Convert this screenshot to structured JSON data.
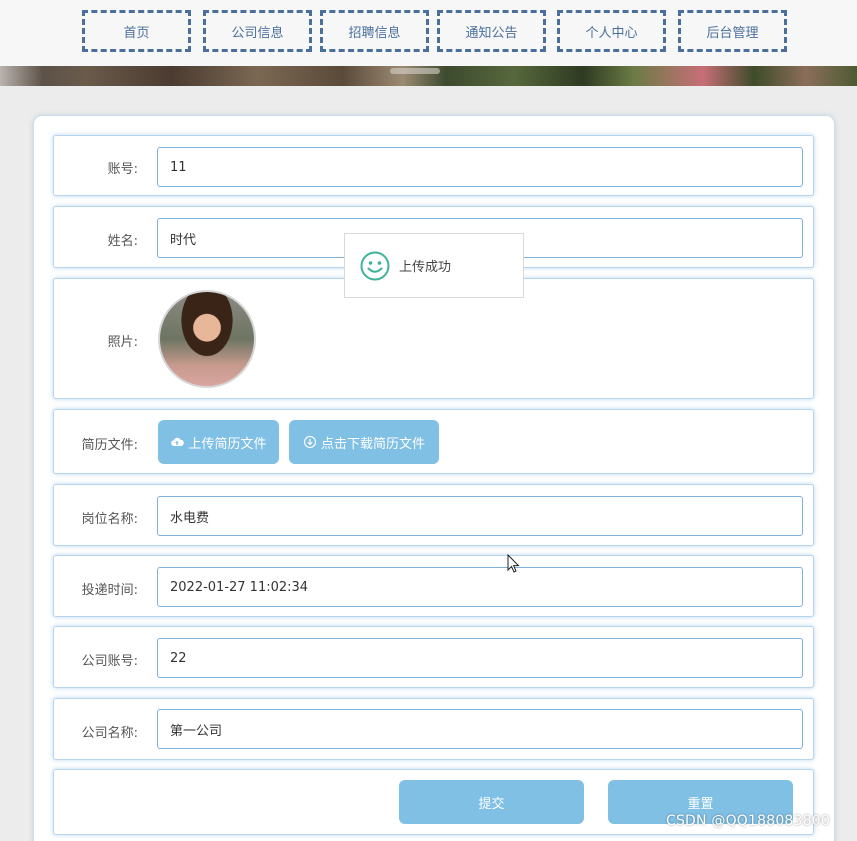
{
  "nav": {
    "items": [
      {
        "label": "首页"
      },
      {
        "label": "公司信息"
      },
      {
        "label": "招聘信息"
      },
      {
        "label": "通知公告"
      },
      {
        "label": "个人中心"
      },
      {
        "label": "后台管理"
      }
    ]
  },
  "form": {
    "account": {
      "label": "账号:",
      "value": "11"
    },
    "name": {
      "label": "姓名:",
      "value": "时代"
    },
    "photo": {
      "label": "照片:"
    },
    "resume": {
      "label": "简历文件:",
      "upload_label": "上传简历文件",
      "download_label": "点击下载简历文件"
    },
    "position": {
      "label": "岗位名称:",
      "value": "水电费"
    },
    "time": {
      "label": "投递时间:",
      "value": "2022-01-27 11:02:34"
    },
    "company_account": {
      "label": "公司账号:",
      "value": "22"
    },
    "company_name": {
      "label": "公司名称:",
      "value": "第一公司"
    },
    "submit_label": "提交",
    "reset_label": "重置"
  },
  "toast": {
    "message": "上传成功",
    "icon": "smile-icon"
  },
  "watermark": "CSDN @QQ188083800",
  "colors": {
    "nav_border": "#4a6f9c",
    "button": "#80c0e5",
    "input_border": "#7fb1dc",
    "toast_icon": "#3fb39a"
  }
}
